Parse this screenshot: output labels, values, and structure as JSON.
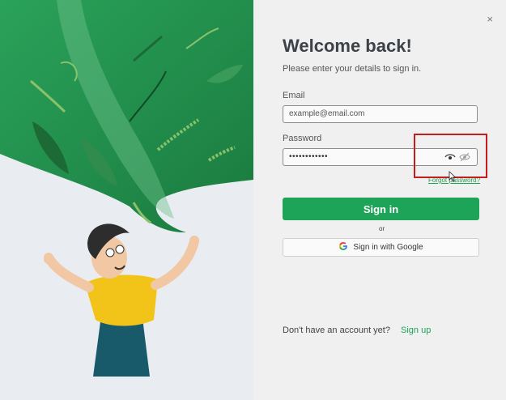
{
  "window": {
    "close_glyph": "×"
  },
  "login": {
    "title": "Welcome back!",
    "subtitle": "Please enter your details to sign in.",
    "email_label": "Email",
    "email_placeholder": "example@email.com",
    "password_label": "Password",
    "password_value": "••••••••••••",
    "forgot_password": "Forgot password?",
    "sign_in": "Sign in",
    "or": "or",
    "google_sign_in": "Sign in with Google",
    "no_account": "Don't have an account yet?",
    "sign_up": "Sign up"
  },
  "icons": {
    "show_password": "eye-icon",
    "hide_password": "eye-slash-icon",
    "google": "google-g-icon"
  },
  "colors": {
    "accent": "#1ea458",
    "highlight": "#c51c1c",
    "illustration_green": "#23a35a",
    "shirt": "#f2c41a"
  }
}
